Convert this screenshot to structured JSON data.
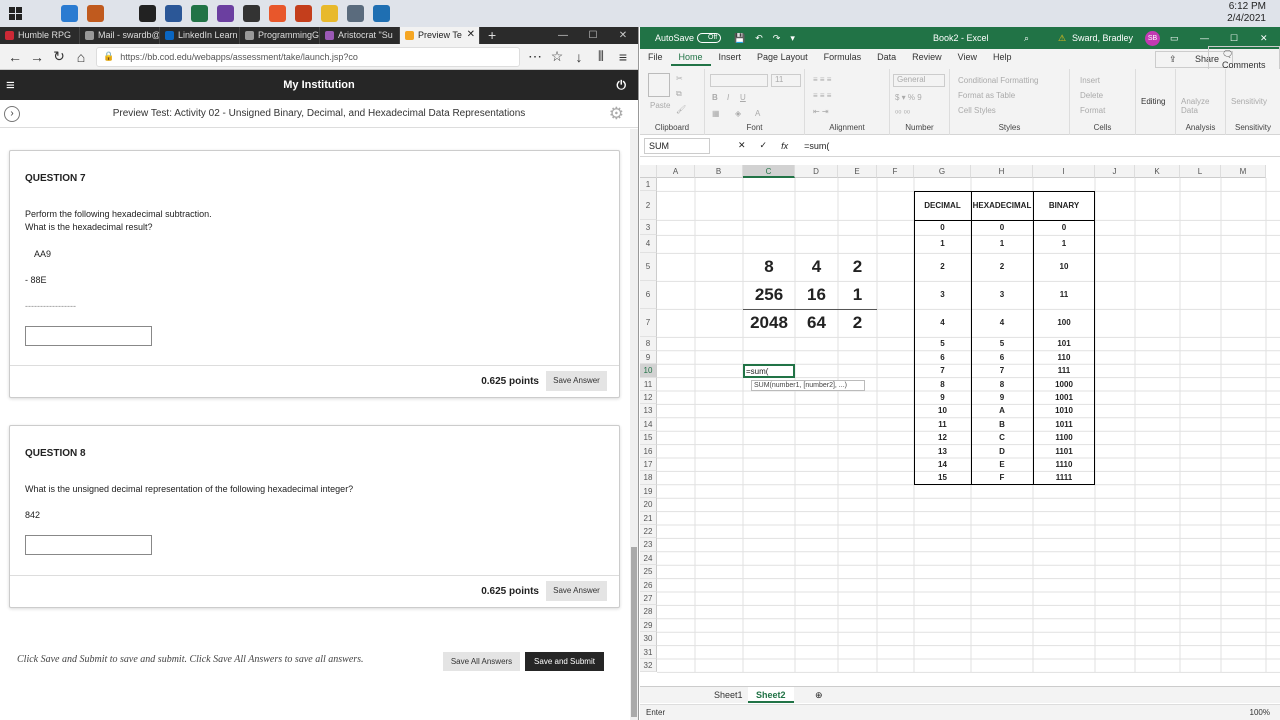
{
  "taskbar": {
    "apps": [
      {
        "icon": "search-icon",
        "color": "#dfe3ea"
      },
      {
        "icon": "vscode-icon",
        "color": "#2a7bd1"
      },
      {
        "icon": "sublime-icon",
        "color": "#c05a1e"
      },
      {
        "icon": "typora-icon",
        "color": "#dfe3ea"
      },
      {
        "icon": "unity-icon",
        "color": "#222222"
      },
      {
        "icon": "word-icon",
        "color": "#2b5797"
      },
      {
        "icon": "excel-icon",
        "color": "#217346"
      },
      {
        "icon": "visualstudio-icon",
        "color": "#6b3fa0"
      },
      {
        "icon": "github-icon",
        "color": "#333333"
      },
      {
        "icon": "firefox-icon",
        "color": "#e8572b"
      },
      {
        "icon": "powerpoint-icon",
        "color": "#c43e1c"
      },
      {
        "icon": "explorer-icon",
        "color": "#e8b92b"
      },
      {
        "icon": "calculator-icon",
        "color": "#5a6b7d"
      },
      {
        "icon": "photos-icon",
        "color": "#1f6fb2"
      }
    ],
    "time": "6:12 PM",
    "date": "2/4/2021"
  },
  "browser": {
    "tabs": [
      {
        "label": "Humble RPG",
        "color": "#cc2936"
      },
      {
        "label": "Mail - swardb@co",
        "color": "#999999"
      },
      {
        "label": "LinkedIn Learn",
        "color": "#0a66c2"
      },
      {
        "label": "ProgrammingGro",
        "color": "#999999"
      },
      {
        "label": "Aristocrat \"Su",
        "color": "#9b59b6"
      },
      {
        "label": "Preview Te",
        "color": "#f5a623"
      }
    ],
    "url": "https://bb.cod.edu/webapps/assessment/take/launch.jsp?co",
    "institution": "My Institution",
    "test_title": "Preview Test: Activity 02 - Unsigned Binary, Decimal, and Hexadecimal Data Representations",
    "q7": {
      "title": "QUESTION 7",
      "line1": "Perform the following hexadecimal subtraction.",
      "line2": "What is the hexadecimal result?",
      "op1": "AA9",
      "op2": "-   88E",
      "rule": "-----------------",
      "points": "0.625 points",
      "save": "Save Answer"
    },
    "q8": {
      "title": "QUESTION 8",
      "line1": "What is the unsigned decimal representation of the following hexadecimal integer?",
      "value": "842",
      "points": "0.625 points",
      "save": "Save Answer"
    },
    "footer_note": "Click Save and Submit to save and submit. Click Save All Answers to save all answers.",
    "save_all": "Save All Answers",
    "save_submit": "Save and Submit"
  },
  "excel": {
    "autosave": "AutoSave",
    "autosave_state": "Off",
    "title": "Book2 - Excel",
    "user": "Sward, Bradley",
    "user_initials": "SB",
    "menus": [
      "File",
      "Home",
      "Insert",
      "Page Layout",
      "Formulas",
      "Data",
      "Review",
      "View",
      "Help"
    ],
    "share": "Share",
    "comments": "Comments",
    "ribbon": {
      "paste": "Paste",
      "font_name": "General",
      "font_size": "11",
      "cond_fmt": "Conditional Formatting",
      "fmt_table": "Format as Table",
      "cell_styles": "Cell Styles",
      "insert": "Insert",
      "delete": "Delete",
      "format": "Format",
      "editing": "Editing",
      "analyze": "Analyze Data",
      "sensitivity": "Sensitivity",
      "groups": [
        "Clipboard",
        "Font",
        "Alignment",
        "Number",
        "Styles",
        "Cells",
        "Analysis",
        "Sensitivity"
      ]
    },
    "name_box": "SUM",
    "formula": "=sum(",
    "columns": [
      "A",
      "B",
      "C",
      "D",
      "E",
      "F",
      "G",
      "H",
      "I",
      "J",
      "K",
      "L",
      "M"
    ],
    "rows": [
      "1",
      "2",
      "3",
      "4",
      "5",
      "6",
      "7",
      "8",
      "9",
      "10",
      "11",
      "12",
      "13",
      "14",
      "15",
      "16",
      "17",
      "18",
      "19",
      "20",
      "21",
      "22",
      "23",
      "24",
      "25",
      "26",
      "27",
      "28",
      "29",
      "30",
      "31",
      "32"
    ],
    "table_headers": [
      "DECIMAL",
      "HEXADECIMAL",
      "BINARY"
    ],
    "table_rows": [
      [
        "0",
        "0",
        "0"
      ],
      [
        "1",
        "1",
        "1"
      ],
      [
        "2",
        "2",
        "10"
      ],
      [
        "3",
        "3",
        "11"
      ],
      [
        "4",
        "4",
        "100"
      ],
      [
        "5",
        "5",
        "101"
      ],
      [
        "6",
        "6",
        "110"
      ],
      [
        "7",
        "7",
        "111"
      ],
      [
        "8",
        "8",
        "1000"
      ],
      [
        "9",
        "9",
        "1001"
      ],
      [
        "10",
        "A",
        "1010"
      ],
      [
        "11",
        "B",
        "1011"
      ],
      [
        "12",
        "C",
        "1100"
      ],
      [
        "13",
        "D",
        "1101"
      ],
      [
        "14",
        "E",
        "1110"
      ],
      [
        "15",
        "F",
        "1111"
      ]
    ],
    "big_values": {
      "r5": [
        "8",
        "4",
        "2"
      ],
      "r6": [
        "256",
        "16",
        "1"
      ],
      "r7": [
        "2048",
        "64",
        "2"
      ]
    },
    "active_cell": "=sum(",
    "tooltip": "SUM(number1, [number2], ...)",
    "sheets": [
      "Sheet1",
      "Sheet2"
    ],
    "active_sheet": "Sheet2",
    "status": "Enter",
    "zoom": "100%"
  }
}
